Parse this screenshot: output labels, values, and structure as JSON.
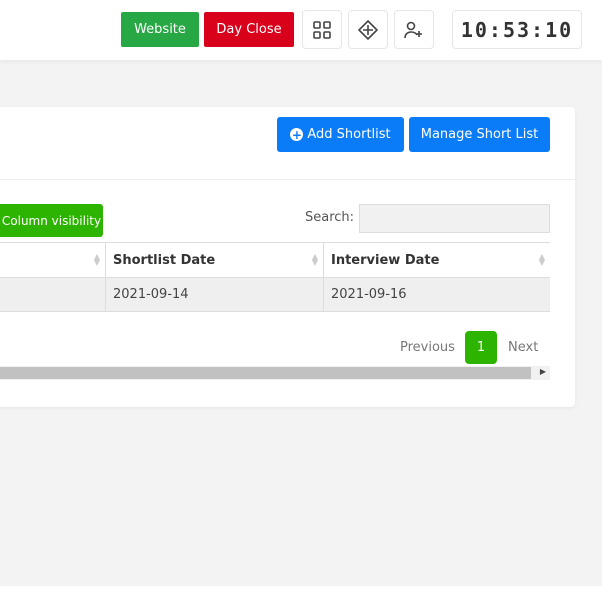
{
  "topbar": {
    "website": "Website",
    "day_close": "Day Close",
    "clock": "10:53:10"
  },
  "card": {
    "add_shortlist": "Add Shortlist",
    "manage": "Manage Short List",
    "column_visibility": "Column visibility",
    "search_label": "Search:",
    "search_value": "",
    "columns": [
      "Shortlist Date",
      "Interview Date"
    ],
    "rows": [
      [
        "2021-09-14",
        "2021-09-16"
      ]
    ],
    "pagination": {
      "previous": "Previous",
      "current": "1",
      "next": "Next"
    }
  }
}
